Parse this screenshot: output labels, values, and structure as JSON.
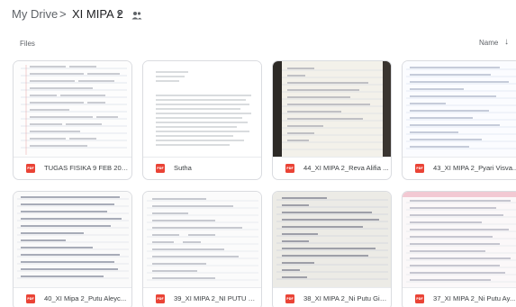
{
  "breadcrumb": {
    "root": "My Drive",
    "separator": ">",
    "current": "XI MIPA 2",
    "dropdown_icon": "chevron-down-icon",
    "shared_icon": "shared-folder-icon"
  },
  "section": {
    "label": "Files"
  },
  "sort": {
    "label": "Name",
    "direction_icon": "arrow-down-icon"
  },
  "colors": {
    "pdf_badge": "#ea4335",
    "card_border": "#dadce0",
    "text": "#3c4043"
  },
  "files": [
    {
      "name": "TUGAS FISIKA 9 FEB 202...",
      "type_badge": "PDF"
    },
    {
      "name": "Sutha",
      "type_badge": "PDF"
    },
    {
      "name": "44_XI MIPA 2_Reva Alifia ...",
      "type_badge": "PDF"
    },
    {
      "name": "43_XI MIPA 2_Pyari Visva...",
      "type_badge": "PDF"
    },
    {
      "name": "40_XI Mipa 2_Putu Aleyc...",
      "type_badge": "PDF"
    },
    {
      "name": "39_XI MIPA 2_NI PUTU M...",
      "type_badge": "PDF"
    },
    {
      "name": "38_XI MIPA 2_Ni Putu Gia...",
      "type_badge": "PDF"
    },
    {
      "name": "37_XI MIPA 2_Ni Putu Ay...",
      "type_badge": "PDF"
    }
  ]
}
